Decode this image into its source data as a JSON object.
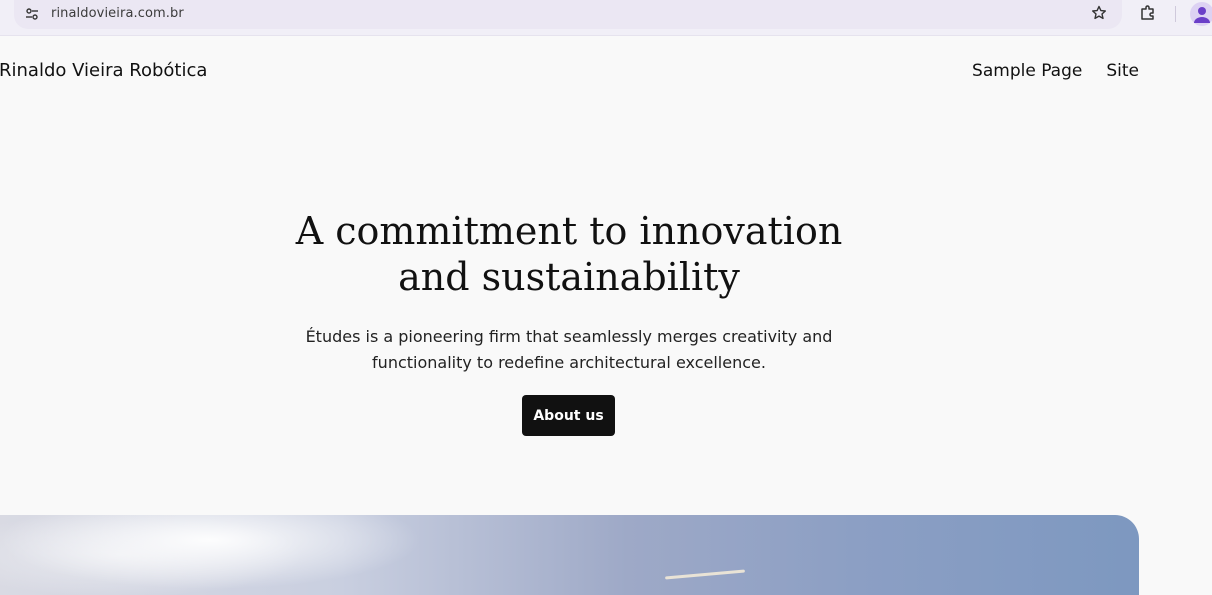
{
  "browser": {
    "url": "rinaldovieira.com.br",
    "icons": [
      "site-info-icon",
      "star-icon",
      "extensions-icon",
      "profile-icon"
    ]
  },
  "site": {
    "title": "Rinaldo Vieira Robótica",
    "nav": [
      {
        "label": "Sample Page"
      },
      {
        "label": "Site"
      }
    ]
  },
  "hero": {
    "title_lines": [
      "A commitment to innovation",
      "and sustainability"
    ],
    "description_lines": [
      "Études is a pioneering firm that seamlessly merges creativity and",
      "functionality to redefine architectural excellence."
    ],
    "button_label": "About us"
  },
  "colors": {
    "page_background": "#f9f9f9",
    "button_background": "#111111",
    "button_text": "#ffffff",
    "browser_bar": "#f1eff7",
    "profile_accent": "#6b3fc8"
  }
}
